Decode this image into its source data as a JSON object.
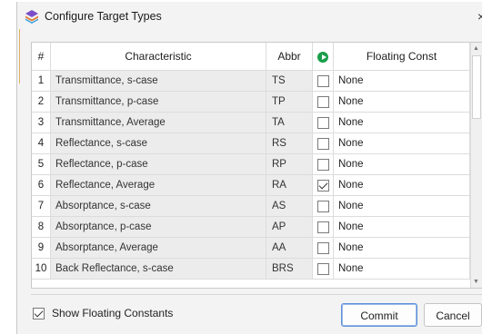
{
  "window": {
    "title": "Configure Target Types",
    "close_glyph": "×",
    "icon": "stacked-layers-icon"
  },
  "grid": {
    "columns": {
      "num": "#",
      "characteristic": "Characteristic",
      "abbr": "Abbr",
      "select_icon": "green-play-circle-icon",
      "floating": "Floating Const"
    },
    "rows": [
      {
        "num": "1",
        "characteristic": "Transmittance, s-case",
        "abbr": "TS",
        "checked": false,
        "floating": "None"
      },
      {
        "num": "2",
        "characteristic": "Transmittance, p-case",
        "abbr": "TP",
        "checked": false,
        "floating": "None"
      },
      {
        "num": "3",
        "characteristic": "Transmittance, Average",
        "abbr": "TA",
        "checked": false,
        "floating": "None"
      },
      {
        "num": "4",
        "characteristic": "Reflectance, s-case",
        "abbr": "RS",
        "checked": false,
        "floating": "None"
      },
      {
        "num": "5",
        "characteristic": "Reflectance, p-case",
        "abbr": "RP",
        "checked": false,
        "floating": "None"
      },
      {
        "num": "6",
        "characteristic": "Reflectance, Average",
        "abbr": "RA",
        "checked": true,
        "floating": "None"
      },
      {
        "num": "7",
        "characteristic": "Absorptance, s-case",
        "abbr": "AS",
        "checked": false,
        "floating": "None"
      },
      {
        "num": "8",
        "characteristic": "Absorptance, p-case",
        "abbr": "AP",
        "checked": false,
        "floating": "None"
      },
      {
        "num": "9",
        "characteristic": "Absorptance, Average",
        "abbr": "AA",
        "checked": false,
        "floating": "None"
      },
      {
        "num": "10",
        "characteristic": "Back Reflectance, s-case",
        "abbr": "BRS",
        "checked": false,
        "floating": "None"
      }
    ]
  },
  "footer": {
    "show_floating_label": "Show Floating Constants",
    "show_floating_checked": true,
    "commit_label": "Commit",
    "cancel_label": "Cancel"
  },
  "colors": {
    "accent_green": "#1a9e4a",
    "focus_blue": "#5b8fd9"
  }
}
